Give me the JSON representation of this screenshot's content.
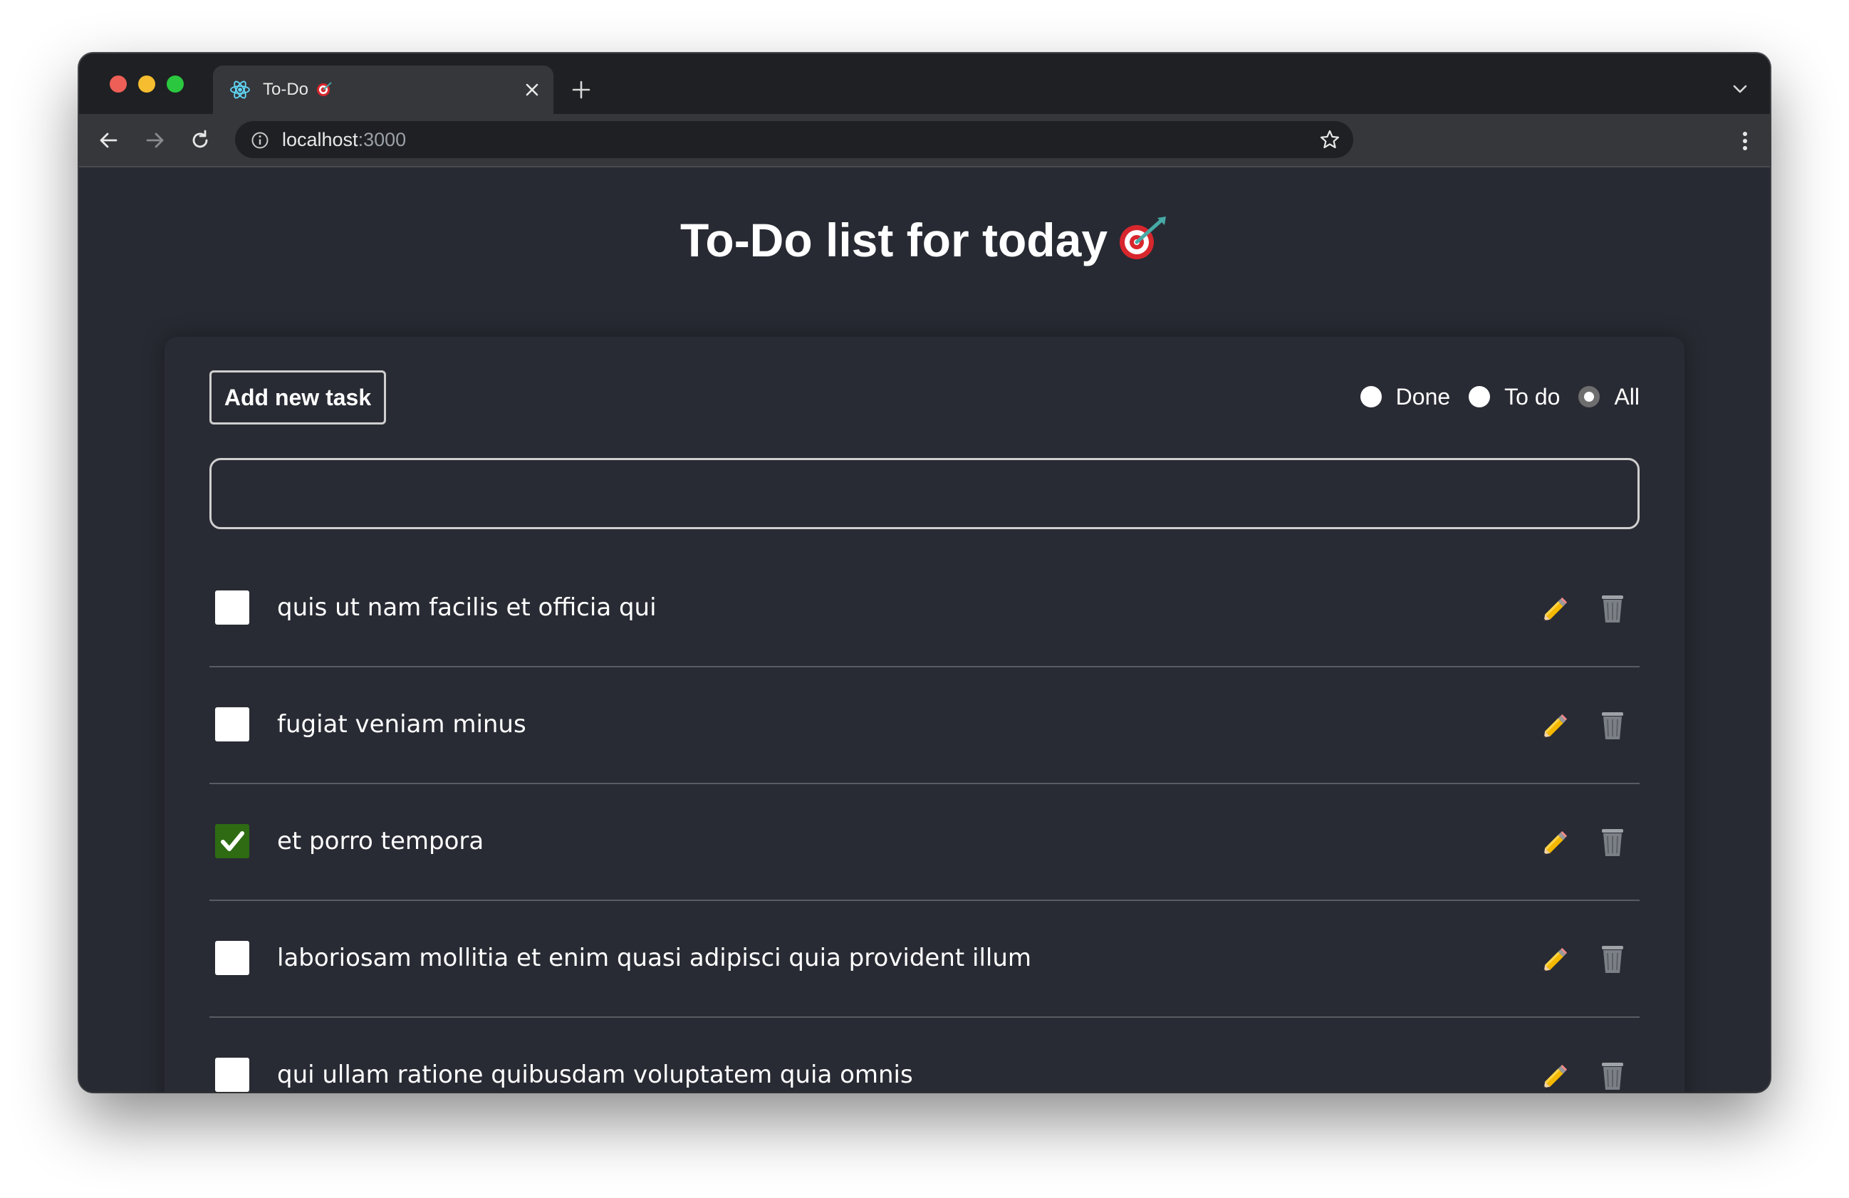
{
  "browser": {
    "tab_title": "To-Do",
    "url_host": "localhost",
    "url_port": ":3000"
  },
  "page": {
    "title": "To-Do list for today"
  },
  "toolbar": {
    "add_button": "Add new task",
    "new_task_value": ""
  },
  "filters": [
    {
      "label": "Done",
      "checked": false
    },
    {
      "label": "To do",
      "checked": false
    },
    {
      "label": "All",
      "checked": true
    }
  ],
  "tasks": [
    {
      "text": "quis ut nam facilis et officia qui",
      "done": false
    },
    {
      "text": "fugiat veniam minus",
      "done": false
    },
    {
      "text": "et porro tempora",
      "done": true
    },
    {
      "text": "laboriosam mollitia et enim quasi adipisci quia provident illum",
      "done": false
    },
    {
      "text": "qui ullam ratione quibusdam voluptatem quia omnis",
      "done": false
    }
  ],
  "icons": {
    "tab_favicon": "react-icon",
    "title_emoji": "direct-hit-icon",
    "edit": "pencil-icon",
    "delete": "wastebasket-icon"
  },
  "colors": {
    "background": "#282a33",
    "checked_box": "#2e6b13",
    "text": "#ffffff"
  }
}
